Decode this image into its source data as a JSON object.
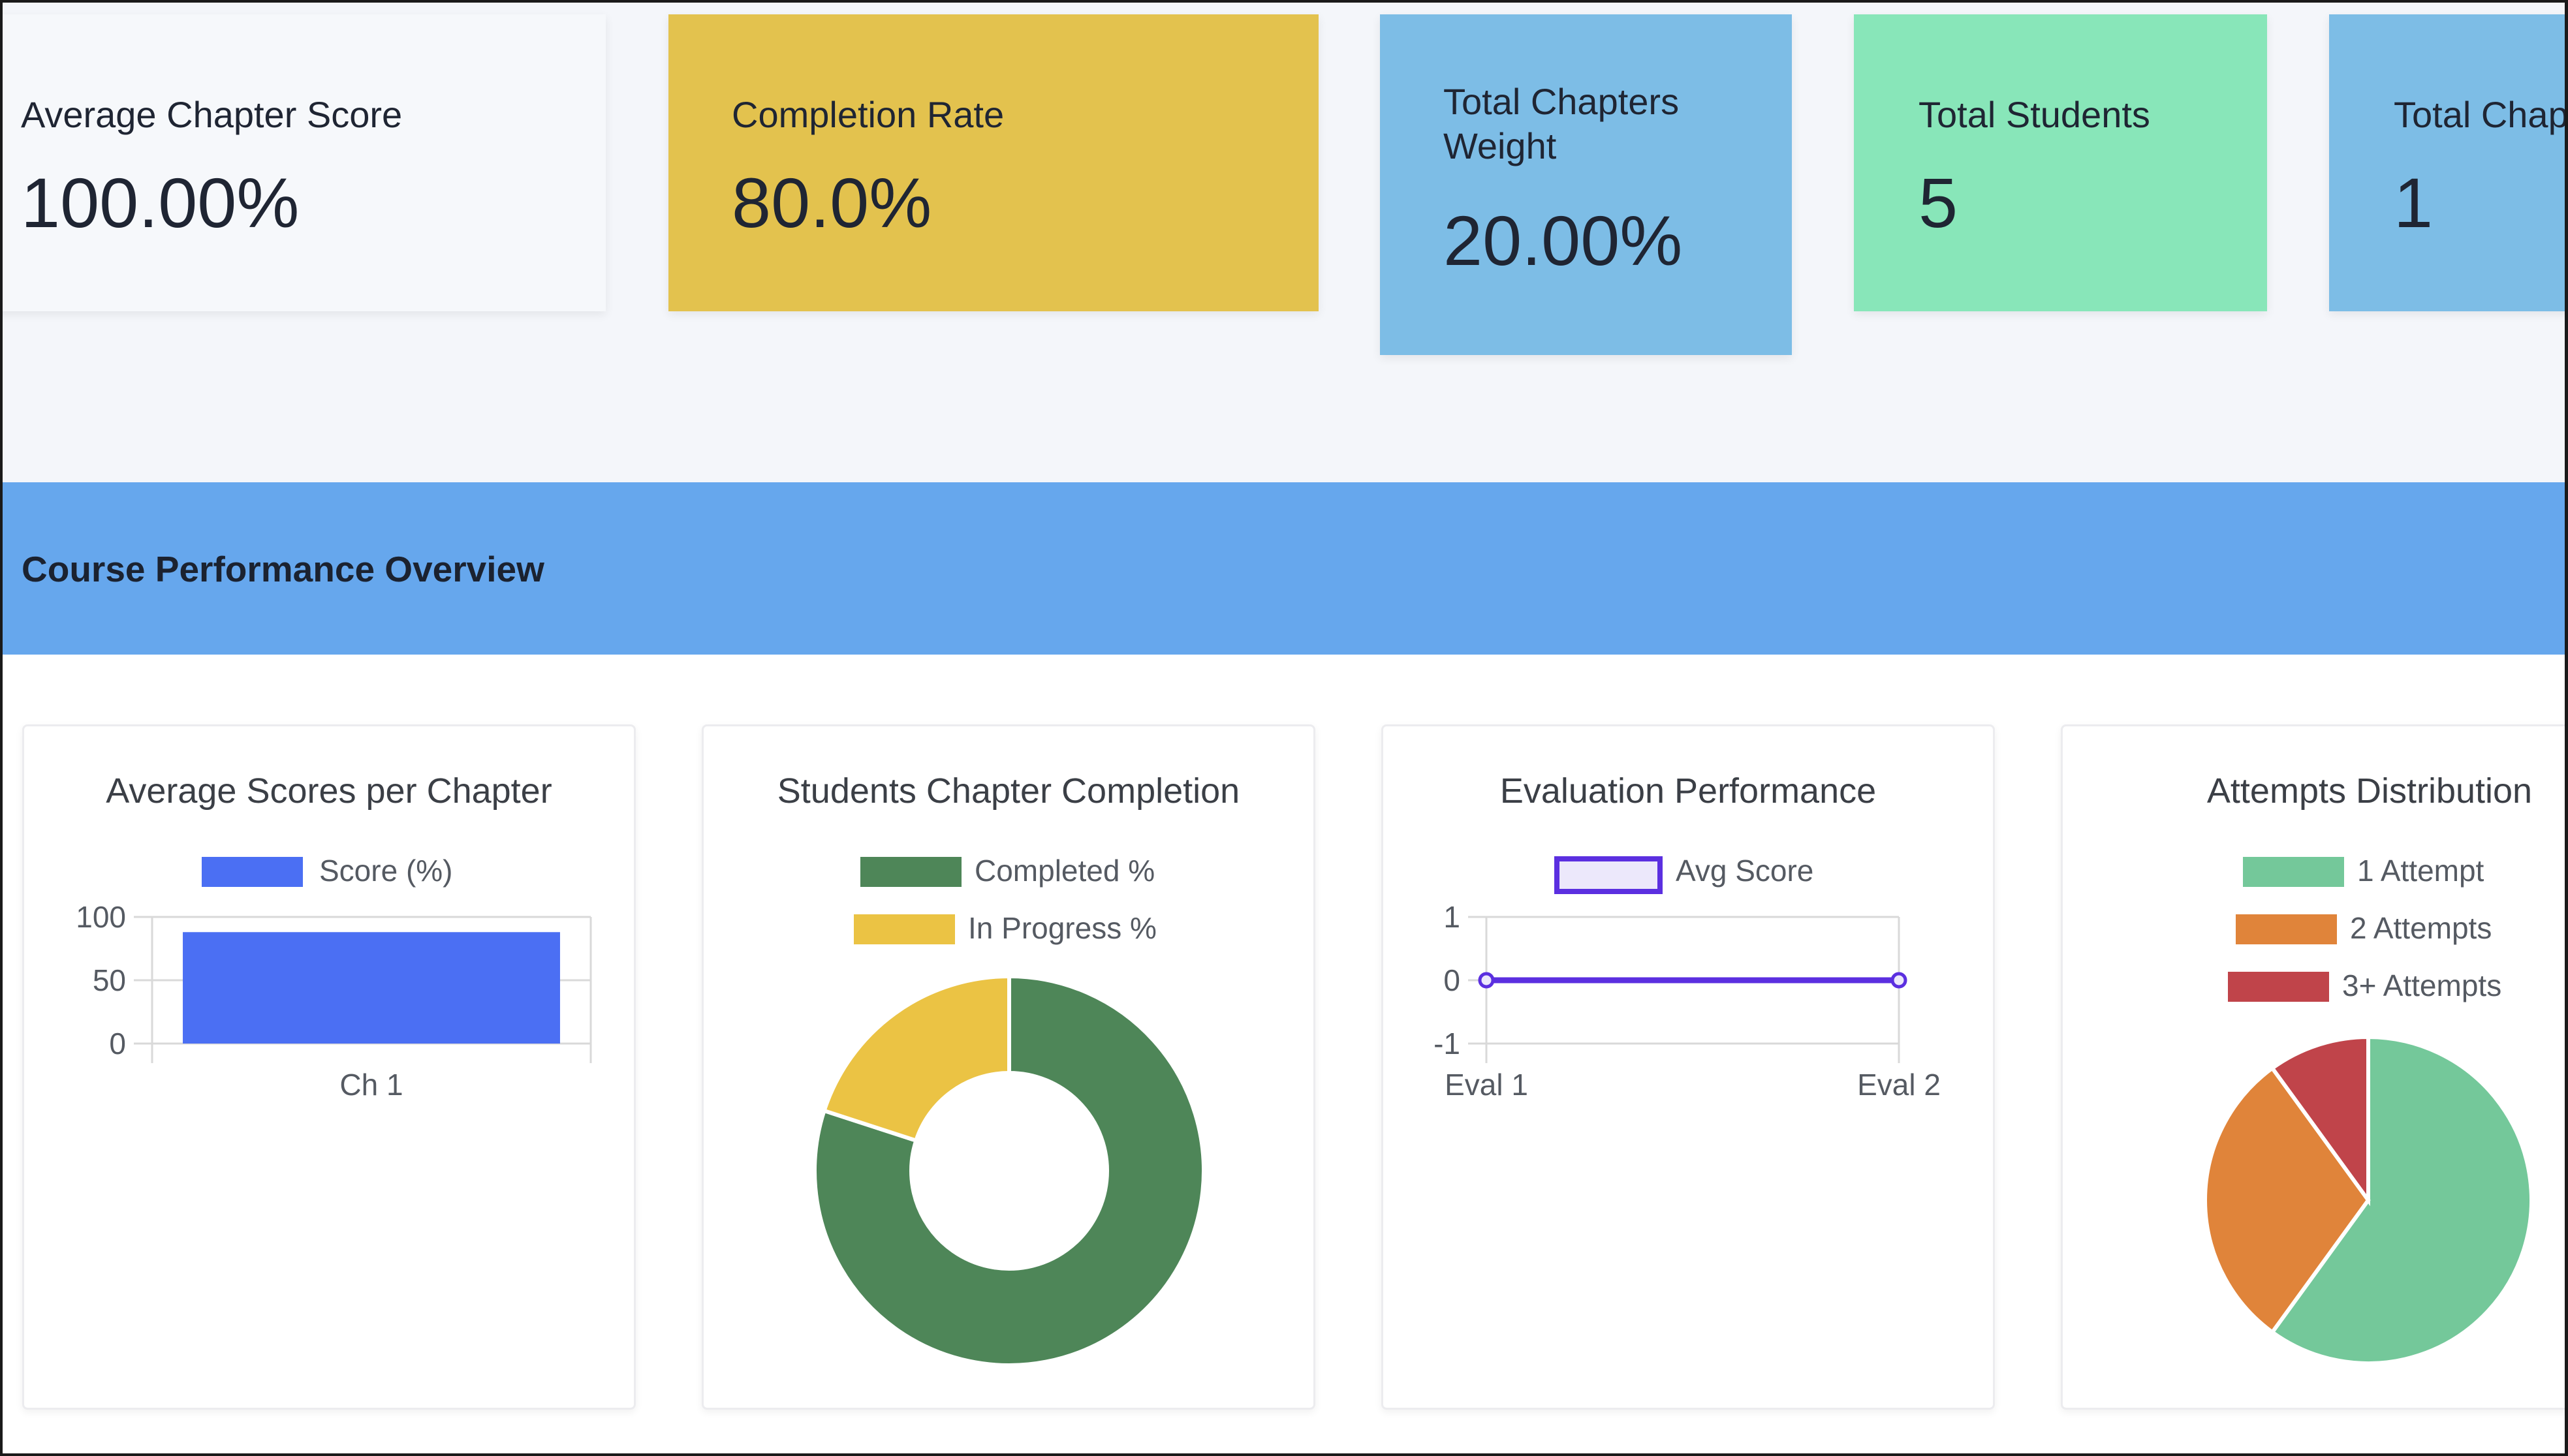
{
  "stats": [
    {
      "label": "Average Chapter Score",
      "value": "100.00%",
      "bg": "#f6f8fb"
    },
    {
      "label": "Completion Rate",
      "value": "80.0%",
      "bg": "#e3c24e"
    },
    {
      "label": "Total Chapters Weight",
      "label_line1": "Total Chapters",
      "label_line2": "Weight",
      "value": "20.00%",
      "bg": "#7dbde6"
    },
    {
      "label": "Total Students",
      "value": "5",
      "bg": "#88e6b9"
    },
    {
      "label": "Total Chap",
      "value": "1",
      "bg": "#7dbde6"
    }
  ],
  "section": {
    "title": "Course Performance Overview",
    "bg": "#66a7ed"
  },
  "chart_data": [
    {
      "type": "bar",
      "title": "Average Scores per Chapter",
      "categories": [
        "Ch 1"
      ],
      "series": [
        {
          "name": "Score (%)",
          "values": [
            88
          ],
          "color": "#4b6ff3"
        }
      ],
      "ylim": [
        0,
        100
      ],
      "yticks": [
        "100",
        "50",
        "0"
      ],
      "legend": "top"
    },
    {
      "type": "pie",
      "variant": "doughnut",
      "title": "Students Chapter Completion",
      "labels": [
        "Completed %",
        "In Progress %"
      ],
      "values": [
        80,
        20
      ],
      "colors": [
        "#4e8658",
        "#ebc344"
      ],
      "legend": "top"
    },
    {
      "type": "line",
      "title": "Evaluation Performance",
      "categories": [
        "Eval 1",
        "Eval 2"
      ],
      "series": [
        {
          "name": "Avg Score",
          "values": [
            0,
            0
          ],
          "color": "#5b2fe0"
        }
      ],
      "ylim": [
        -1,
        1
      ],
      "yticks": [
        "1",
        "0",
        "-1"
      ],
      "legend": "top"
    },
    {
      "type": "pie",
      "title": "Attempts Distribution",
      "labels": [
        "1 Attempt",
        "2 Attempts",
        "3+ Attempts"
      ],
      "values": [
        60,
        30,
        10
      ],
      "colors": [
        "#74c89a",
        "#e0843a",
        "#c0444a"
      ],
      "legend": "top"
    }
  ]
}
